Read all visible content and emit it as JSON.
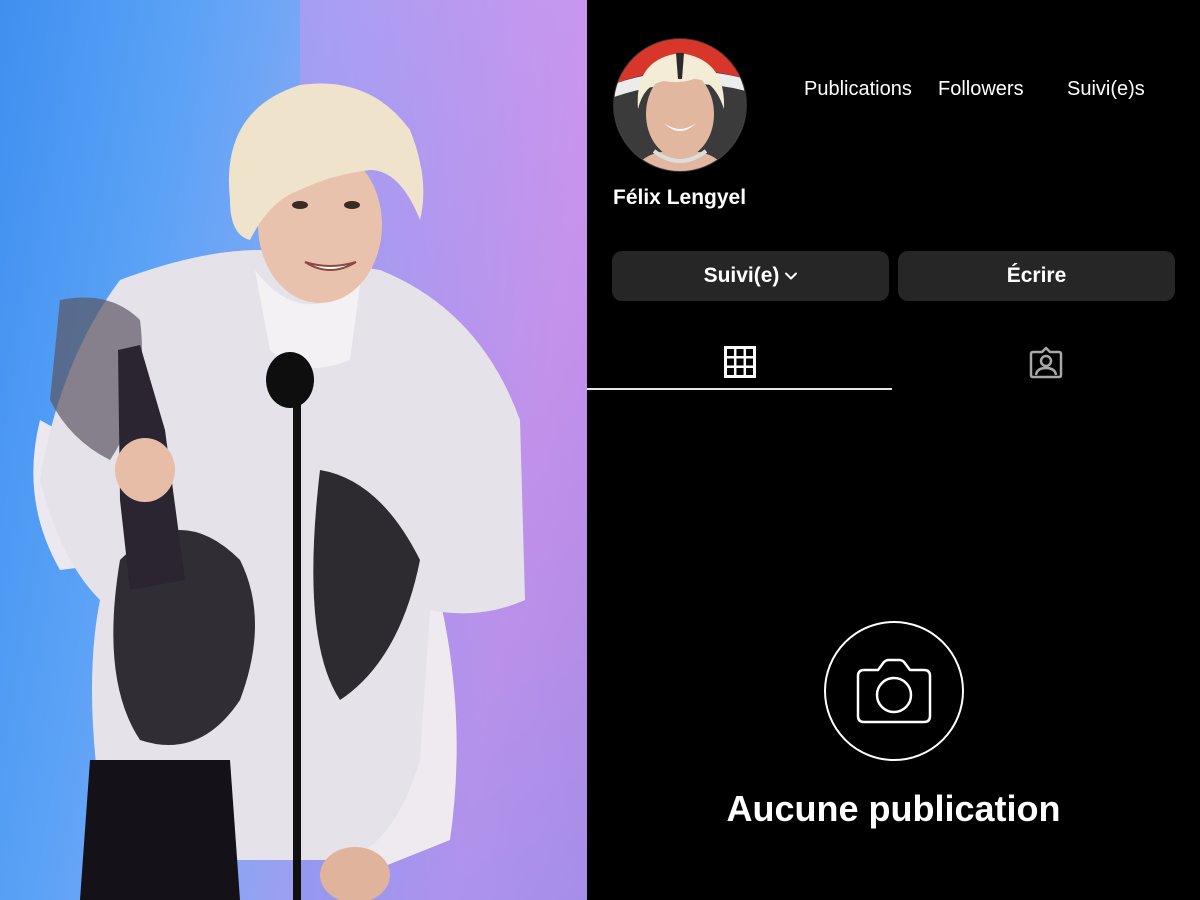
{
  "photo": {
    "description": "Man with bleached blond hair holding an award trophy at a microphone on stage",
    "background_colors": [
      "#3f8ff0",
      "#a79cf0",
      "#c496ea"
    ]
  },
  "profile": {
    "display_name": "Félix Lengyel",
    "avatar_alt": "Profile photo of Félix Lengyel",
    "stats": {
      "posts_label": "Publications",
      "followers_label": "Followers",
      "following_label": "Suivi(e)s"
    }
  },
  "actions": {
    "following_label": "Suivi(e)",
    "following_icon": "chevron-down-icon",
    "message_label": "Écrire"
  },
  "tabs": [
    {
      "name": "posts-grid",
      "icon": "grid-icon",
      "active": true
    },
    {
      "name": "tagged",
      "icon": "tagged-person-icon",
      "active": false
    }
  ],
  "empty_state": {
    "icon": "camera-icon",
    "title": "Aucune publication"
  },
  "colors": {
    "background": "#000000",
    "button_bg": "#262626",
    "text": "#ffffff",
    "inactive_icon": "#a8a8a8"
  }
}
